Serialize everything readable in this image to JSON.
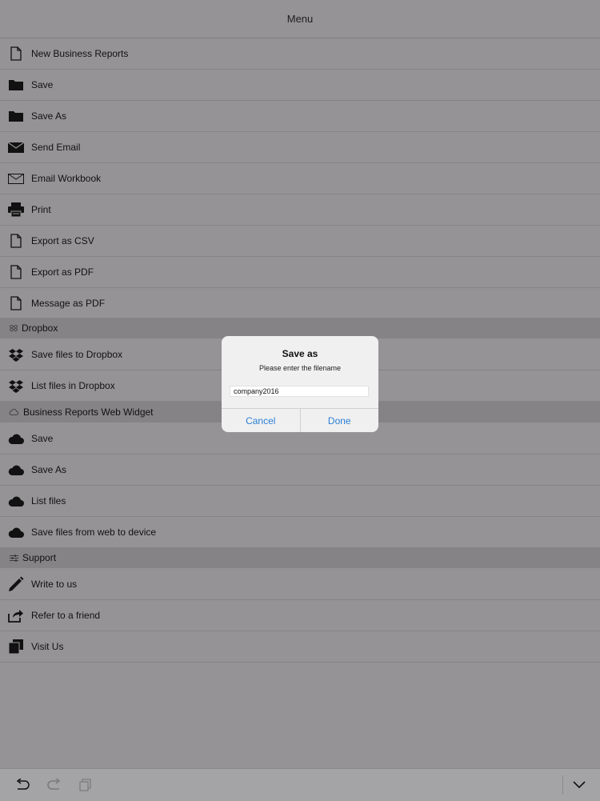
{
  "header": {
    "title": "Menu"
  },
  "menu_items": [
    {
      "label": "New Business Reports",
      "icon": "document-icon"
    },
    {
      "label": "Save",
      "icon": "folder-icon"
    },
    {
      "label": "Save As",
      "icon": "folder-icon"
    },
    {
      "label": "Send Email",
      "icon": "mail-filled-icon"
    },
    {
      "label": "Email Workbook",
      "icon": "mail-outline-icon"
    },
    {
      "label": "Print",
      "icon": "printer-icon"
    },
    {
      "label": "Export as CSV",
      "icon": "document-icon"
    },
    {
      "label": "Export as PDF",
      "icon": "document-icon"
    },
    {
      "label": "Message as PDF",
      "icon": "document-icon"
    }
  ],
  "sections": {
    "dropbox": {
      "title": "Dropbox",
      "icon": "dropbox-small-icon",
      "items": [
        {
          "label": "Save files to Dropbox",
          "icon": "dropbox-icon"
        },
        {
          "label": "List files in Dropbox",
          "icon": "dropbox-icon"
        }
      ]
    },
    "web_widget": {
      "title": "Business Reports Web Widget",
      "icon": "cloud-outline-icon",
      "items": [
        {
          "label": "Save",
          "icon": "cloud-icon"
        },
        {
          "label": "Save As",
          "icon": "cloud-icon"
        },
        {
          "label": "List files",
          "icon": "cloud-icon"
        },
        {
          "label": "Save files from web to device",
          "icon": "cloud-icon"
        }
      ]
    },
    "support": {
      "title": "Support",
      "icon": "settings-sliders-icon",
      "items": [
        {
          "label": "Write to us",
          "icon": "pencil-icon"
        },
        {
          "label": "Refer to a friend",
          "icon": "share-icon"
        },
        {
          "label": "Visit Us",
          "icon": "pages-icon"
        }
      ]
    }
  },
  "dialog": {
    "title": "Save as",
    "message": "Please enter the filename",
    "filename_value": "company2016",
    "cancel_label": "Cancel",
    "done_label": "Done"
  },
  "toolbar": {
    "icons": [
      "undo-icon",
      "redo-icon",
      "copy-icon",
      "chevron-down-icon"
    ]
  },
  "colors": {
    "background": "#959396",
    "accent": "#2a7fd6",
    "dialog_bg": "#f0f0f0"
  }
}
